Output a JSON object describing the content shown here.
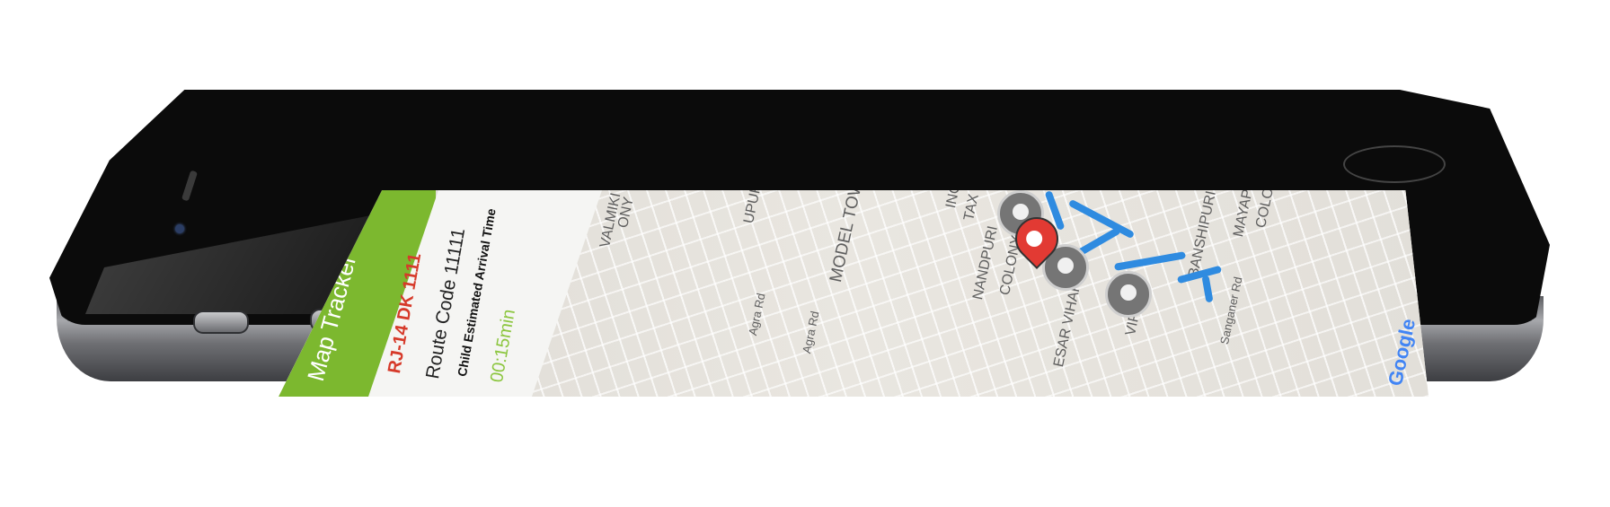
{
  "app": {
    "title": "Map Tracker"
  },
  "info": {
    "vehicle_number": "RJ-14 DK 1111",
    "route_code": "Route Code 11111",
    "eta_label": "Child Estimated Arrival Time",
    "eta_value": "00:15min"
  },
  "map_labels": {
    "valmiki": "VALMIKI",
    "ony": "ONY",
    "upuri": "UPURI",
    "model_town": "MODEL TOWN",
    "agra_road": "Agra Rd",
    "nandpuri": "NANDPURI",
    "colony": "COLONY",
    "esar_vihar": "ESAR VIHAR",
    "vipra": "VIPRA",
    "sanganer_rd": "Sanganer Rd",
    "banshipuri": "BANSHIPURI - I",
    "mayapu": "MAYAPU",
    "colon": "COLON",
    "inc": "INC",
    "tax_c": "TAX C"
  },
  "map_attribution": "Google",
  "colors": {
    "header_green": "#7cb82f",
    "route_blue": "#2f8be0",
    "vehicle_red": "#d63a2a",
    "eta_green": "#8cc63f"
  },
  "icons": [
    "bus-stop-pin-icon",
    "child-location-pin-icon",
    "google-logo"
  ]
}
